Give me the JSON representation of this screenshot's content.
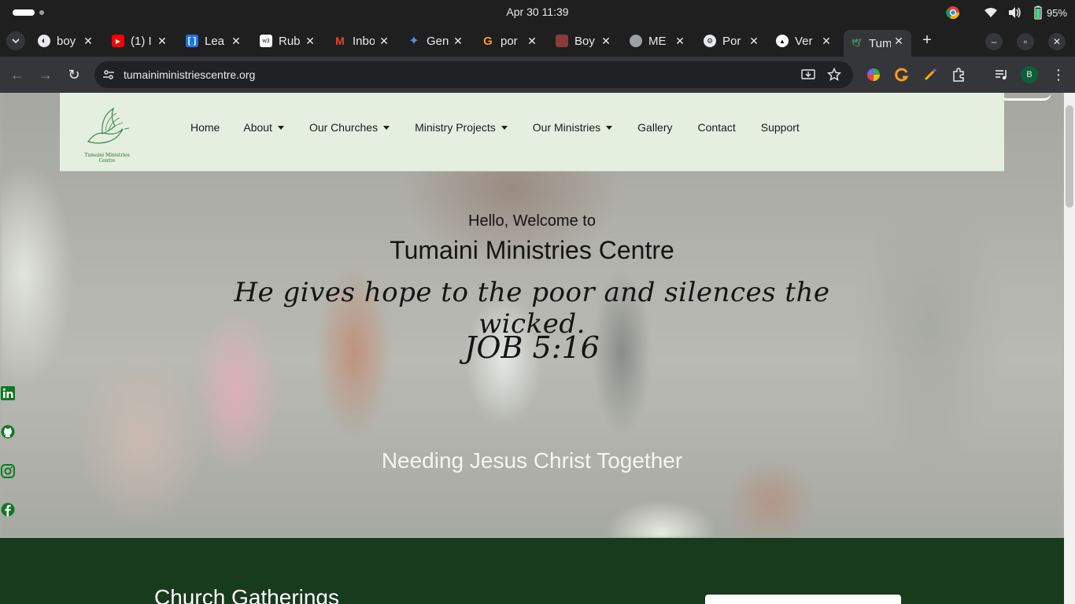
{
  "os": {
    "clock": "Apr 30  11:39",
    "battery": "95%"
  },
  "tabs": [
    {
      "label": "boy",
      "icon": "github-icon"
    },
    {
      "label": "(1) I",
      "icon": "youtube-icon"
    },
    {
      "label": "Lea",
      "icon": "leetcode-bracket-icon"
    },
    {
      "label": "Rub",
      "icon": "rubric-icon"
    },
    {
      "label": "Inbo",
      "icon": "gmail-icon"
    },
    {
      "label": "Gen",
      "icon": "gemini-icon"
    },
    {
      "label": "por",
      "icon": "grammarly-icon"
    },
    {
      "label": "Boy",
      "icon": "profile-photo-icon"
    },
    {
      "label": "ME",
      "icon": "globe-icon"
    },
    {
      "label": "Por",
      "icon": "openai-icon"
    },
    {
      "label": "Ver",
      "icon": "vercel-icon"
    },
    {
      "label": "Tum",
      "icon": "dove-icon",
      "active": true
    }
  ],
  "toolbar": {
    "url": "tumainiministriescentre.org",
    "profile_initial": "B"
  },
  "header": {
    "logo_text": "Tumaini Ministries Centre",
    "nav": [
      {
        "label": "Home",
        "dropdown": false
      },
      {
        "label": "About",
        "dropdown": true
      },
      {
        "label": "Our Churches",
        "dropdown": true
      },
      {
        "label": "Ministry Projects",
        "dropdown": true
      },
      {
        "label": "Our Ministries",
        "dropdown": true
      },
      {
        "label": "Gallery",
        "dropdown": false
      },
      {
        "label": "Contact",
        "dropdown": false
      },
      {
        "label": "Support",
        "dropdown": false
      }
    ]
  },
  "hero": {
    "greeting": "Hello, Welcome to",
    "title": "Tumaini Ministries Centre",
    "tagline": "He gives hope to the poor and silences the wicked.",
    "verse": "JOB 5:16",
    "motto": "Needing Jesus Christ Together"
  },
  "social": [
    "linkedin-icon",
    "github-icon",
    "instagram-icon",
    "facebook-icon"
  ],
  "section": {
    "heading": "Church Gatherings"
  },
  "colors": {
    "header_bg": "#e4efe0",
    "brand_green": "#183a1d",
    "social_green": "#0b7a1f"
  }
}
